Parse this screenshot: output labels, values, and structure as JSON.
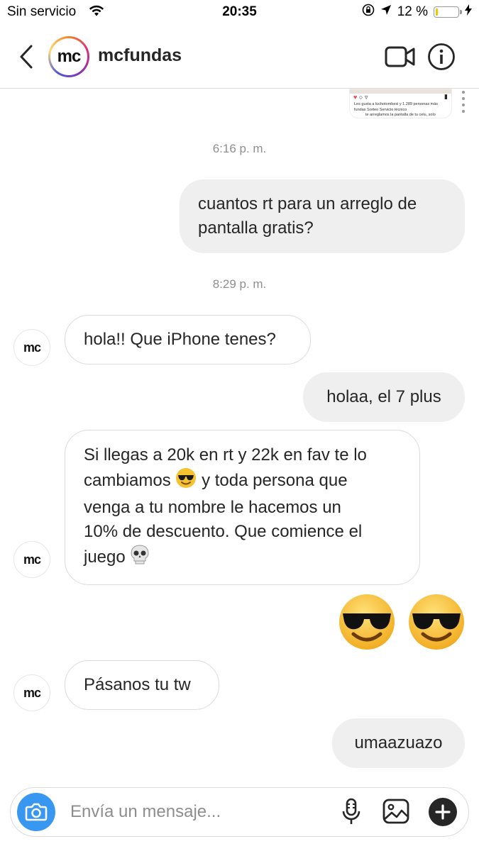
{
  "status_bar": {
    "carrier": "Sin servicio",
    "time": "20:35",
    "battery_percent": "12 %",
    "battery_level": 0.12
  },
  "header": {
    "username": "mcfundas",
    "avatar_logo": "mc"
  },
  "shared_post_preview": {
    "likes_line": "Les gusta a luchotombesi y 1.289 personas más",
    "caption_line": "fundas Sorteo Servicio técnico",
    "caption_line2": "te arreglamos la pantalla de tu celu, solo"
  },
  "messages": [
    {
      "type": "timestamp",
      "text": "6:16 p. m."
    },
    {
      "type": "sent",
      "text": "cuantos rt para un arreglo de pantalla gratis?"
    },
    {
      "type": "timestamp",
      "text": "8:29 p. m."
    },
    {
      "type": "received",
      "text": "hola!! Que iPhone tenes?"
    },
    {
      "type": "sent",
      "text": "holaa, el 7 plus"
    },
    {
      "type": "received",
      "text_line1": "Si llegas a 20k en rt y 22k en fav te lo",
      "text_line2a": "cambiamos",
      "text_line2b": "y toda persona que",
      "text_line3": "venga a tu nombre le hacemos un",
      "text_line4": "10% de descuento. Que comience el",
      "text_line5": "juego"
    },
    {
      "type": "sent_emoji",
      "emojis": [
        "smiling-face-with-sunglasses",
        "smiling-face-with-sunglasses"
      ]
    },
    {
      "type": "received",
      "text": "Pásanos tu tw"
    },
    {
      "type": "sent",
      "text": "umaazuazo"
    }
  ],
  "composer": {
    "placeholder": "Envía un mensaje..."
  }
}
